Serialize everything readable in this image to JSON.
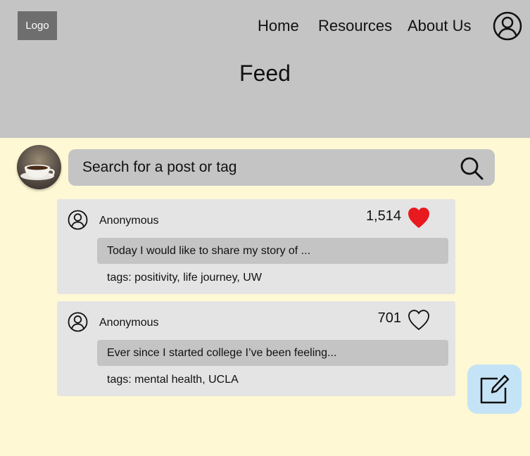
{
  "header": {
    "logo_text": "Logo",
    "nav": {
      "home": "Home",
      "resources": "Resources",
      "about": "About Us"
    },
    "page_title": "Feed"
  },
  "search": {
    "placeholder": "Search for a post or tag"
  },
  "posts": [
    {
      "author": "Anonymous",
      "likes": "1,514",
      "liked": true,
      "preview": "Today I would like to share my story of ...",
      "tags": "tags: positivity, life journey, UW"
    },
    {
      "author": "Anonymous",
      "likes": "701",
      "liked": false,
      "preview": "Ever since I started college I’ve been feeling...",
      "tags": "tags: mental health, UCLA"
    }
  ],
  "icons": {
    "profile": "profile-icon",
    "search": "search-icon",
    "user": "user-icon",
    "heart_filled": "heart-filled-icon",
    "heart_outline": "heart-outline-icon",
    "compose": "compose-icon"
  },
  "colors": {
    "background": "#fff8d4",
    "header": "#c4c4c4",
    "card": "#e4e4e4",
    "liked_heart": "#e8191f",
    "compose_button": "#c5e3f6"
  }
}
